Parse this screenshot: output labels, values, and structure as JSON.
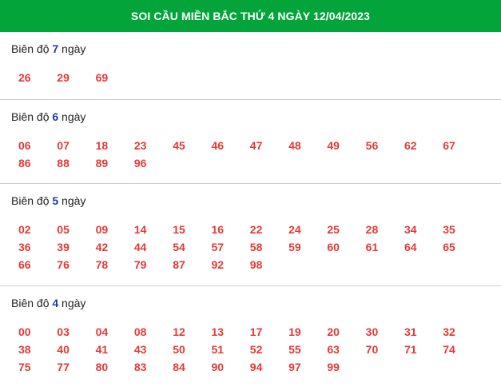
{
  "header": {
    "title": "SOI CẦU MIỀN BẮC THỨ 4 NGÀY 12/04/2023",
    "bg_color": "#03a53a"
  },
  "colors": {
    "number": "#e53935",
    "amplitude": "#1a3aa8"
  },
  "sections": [
    {
      "label_prefix": "Biên độ ",
      "amplitude": "7",
      "label_suffix": " ngày",
      "numbers": [
        "26",
        "29",
        "69"
      ]
    },
    {
      "label_prefix": "Biên độ ",
      "amplitude": "6",
      "label_suffix": " ngày",
      "numbers": [
        "06",
        "07",
        "18",
        "23",
        "45",
        "46",
        "47",
        "48",
        "49",
        "56",
        "62",
        "67",
        "86",
        "88",
        "89",
        "96"
      ]
    },
    {
      "label_prefix": "Biên độ ",
      "amplitude": "5",
      "label_suffix": " ngày",
      "numbers": [
        "02",
        "05",
        "09",
        "14",
        "15",
        "16",
        "22",
        "24",
        "25",
        "28",
        "34",
        "35",
        "36",
        "39",
        "42",
        "44",
        "54",
        "57",
        "58",
        "59",
        "60",
        "61",
        "64",
        "65",
        "66",
        "76",
        "78",
        "79",
        "87",
        "92",
        "98"
      ]
    },
    {
      "label_prefix": "Biên độ ",
      "amplitude": "4",
      "label_suffix": " ngày",
      "numbers": [
        "00",
        "03",
        "04",
        "08",
        "12",
        "13",
        "17",
        "19",
        "20",
        "30",
        "31",
        "32",
        "38",
        "40",
        "41",
        "43",
        "50",
        "51",
        "52",
        "55",
        "63",
        "70",
        "71",
        "74",
        "75",
        "77",
        "80",
        "83",
        "84",
        "90",
        "94",
        "97",
        "99"
      ]
    }
  ]
}
